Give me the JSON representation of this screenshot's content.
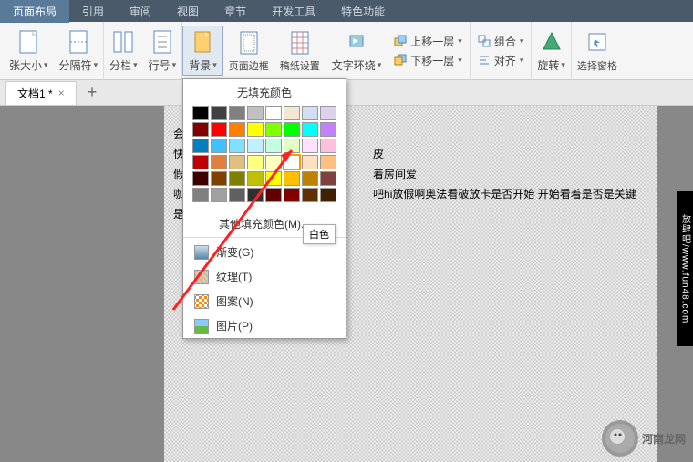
{
  "tabs": {
    "items": [
      "页面布局",
      "引用",
      "审阅",
      "视图",
      "章节",
      "开发工具",
      "特色功能"
    ],
    "active": 0
  },
  "ribbon": {
    "size": "张大小",
    "breaks": "分隔符",
    "columns": "分栏",
    "lineNum": "行号",
    "background": "背景",
    "border": "页面边框",
    "paper": "稿纸设置",
    "wrap": "文字环绕",
    "up": "上移一层",
    "down": "下移一层",
    "align": "对齐",
    "group": "组合",
    "rotate": "旋转",
    "selpane": "选择窗格"
  },
  "doc": {
    "name": "文档1 *"
  },
  "dropdown": {
    "title": "无填充颜色",
    "more": "其他填充颜色(M)...",
    "items": {
      "gradient": "渐变(G)",
      "texture": "纹理(T)",
      "pattern": "图案(N)",
      "picture": "图片(P)"
    },
    "tooltip": "白色"
  },
  "text": {
    "l1": "会收",
    "l2": "快乐",
    "l3": "假拉",
    "l4": "咖啡",
    "l5": "是",
    "r2": "皮",
    "r3": "着房间爱",
    "r4": "吧hi放假啊奥法看破放卡是否开始  开始看着是否是关键"
  },
  "sidebar": "放肆吧/www.fun48.com",
  "watermark": "河南龙网",
  "colors": [
    [
      "#000000",
      "#404040",
      "#808080",
      "#c0c0c0",
      "#ffffff",
      "#f4e6d0",
      "#d0e0f0",
      "#e0d0f0"
    ],
    [
      "#800000",
      "#ff0000",
      "#ff8000",
      "#ffff00",
      "#80ff00",
      "#00ff00",
      "#00ffff",
      "#c080ff"
    ],
    [
      "#0080c0",
      "#40c0ff",
      "#80e0ff",
      "#c0f0ff",
      "#c0ffe0",
      "#e0ffc0",
      "#ffe0ff",
      "#ffc0e0"
    ],
    [
      "#c00000",
      "#e08040",
      "#e0c080",
      "#ffff80",
      "#ffffc0",
      "#ffffff",
      "#ffe0c0",
      "#ffc080"
    ],
    [
      "#400000",
      "#804000",
      "#808000",
      "#c0c000",
      "#ffff00",
      "#ffc000",
      "#c08000",
      "#804040"
    ],
    [
      "#808080",
      "#a0a0a0",
      "#606060",
      "#303030",
      "#600000",
      "#800000",
      "#603000",
      "#402000"
    ]
  ]
}
